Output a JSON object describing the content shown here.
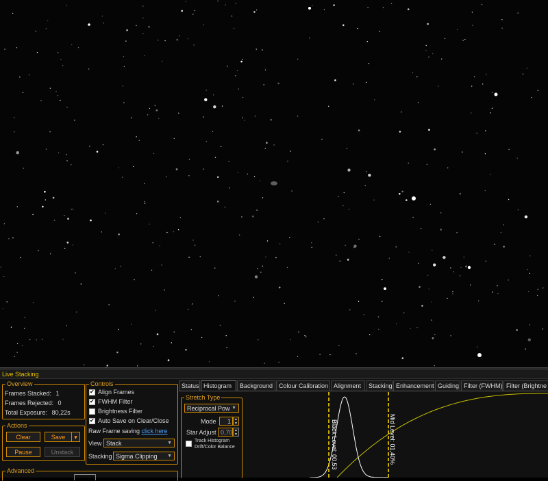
{
  "panel_title": "Live Stacking",
  "overview": {
    "title": "Overview",
    "rows": [
      {
        "label": "Frames Stacked:",
        "value": "1"
      },
      {
        "label": "Frames Rejected:",
        "value": "0"
      },
      {
        "label": "Total Exposure:",
        "value": "80,22s"
      }
    ]
  },
  "actions": {
    "title": "Actions",
    "clear": "Clear",
    "save": "Save",
    "save_arrow": "▾",
    "pause": "Pause",
    "unstack": "Unstack"
  },
  "advanced": {
    "title": "Advanced"
  },
  "controls": {
    "title": "Controls",
    "checks": [
      {
        "label": "Align Frames",
        "checked": true
      },
      {
        "label": "FWHM Filter",
        "checked": true
      },
      {
        "label": "Brightness Filter",
        "checked": false
      },
      {
        "label": "Auto Save on Clear/Close",
        "checked": true
      }
    ],
    "raw_label": "Raw Frame saving",
    "raw_link": "click here",
    "view_label": "View",
    "view_value": "Stack",
    "stacking_label": "Stacking",
    "stacking_value": "Sigma Clipping"
  },
  "tabs": [
    "Status",
    "Histogram",
    "Background",
    "Colour Calibration",
    "Alignment",
    "Stacking",
    "Enhancement",
    "Guiding",
    "Filter (FWHM)",
    "Filter (Brightne"
  ],
  "active_tab": 1,
  "stretch": {
    "title": "Stretch Type",
    "type_value": "Reciprocal Pow",
    "mode_label": "Mode",
    "mode_value": "1",
    "star_label": "Star Adjust",
    "star_value": "0,70",
    "track_line1": "Track Histogram",
    "track_line2": "Drift/Color Balance",
    "track_checked": false
  },
  "histogram": {
    "black_level_label": "Black Level: 00,53",
    "mid_level_label": "Mid Level: 01,40%",
    "curve_color": "#c8c000",
    "marker_color": "#ffe000"
  },
  "colors": {
    "accent": "#d08a00",
    "title": "#e6c200",
    "link": "#4da3ff"
  }
}
